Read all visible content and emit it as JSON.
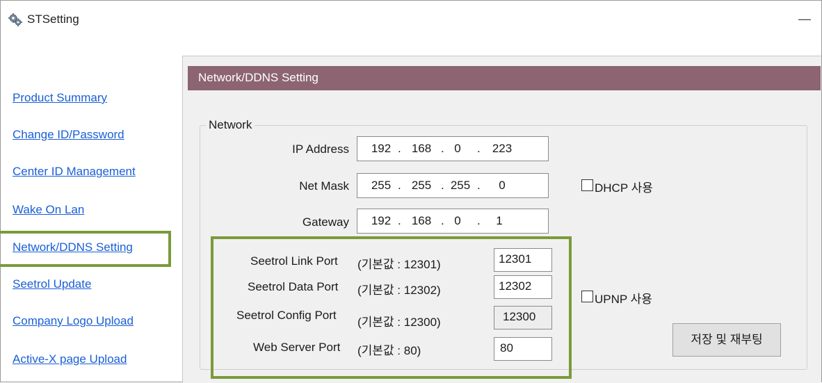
{
  "window": {
    "title": "STSetting",
    "minimize_glyph": "—",
    "app_icon": "gear-icon"
  },
  "sidebar": {
    "items": [
      {
        "label": "Product Summary"
      },
      {
        "label": "Change ID/Password"
      },
      {
        "label": "Center ID Management"
      },
      {
        "label": "Wake On Lan"
      },
      {
        "label": "Network/DDNS Setting",
        "highlighted": true
      },
      {
        "label": "Seetrol Update"
      },
      {
        "label": "Company Logo Upload"
      },
      {
        "label": "Active-X page Upload"
      }
    ]
  },
  "panel": {
    "header": "Network/DDNS Setting",
    "group_label": "Network",
    "ip_address": {
      "label": "IP Address",
      "octets": [
        "192",
        "168",
        "0",
        "223"
      ]
    },
    "net_mask": {
      "label": "Net Mask",
      "octets": [
        "255",
        "255",
        "255",
        "0"
      ]
    },
    "gateway": {
      "label": "Gateway",
      "octets": [
        "192",
        "168",
        "0",
        "1"
      ]
    },
    "dhcp": {
      "label": "DHCP 사용",
      "checked": false
    },
    "upnp": {
      "label": "UPNP 사용",
      "checked": false
    },
    "ports": [
      {
        "label": "Seetrol Link Port",
        "default": "(기본값 : 12301)",
        "value": "12301"
      },
      {
        "label": "Seetrol Data Port",
        "default": "(기본값 : 12302)",
        "value": "12302"
      },
      {
        "label": "Seetrol Config Port",
        "default": "(기본값 : 12300)",
        "value": "12300",
        "readonly": true
      },
      {
        "label": "Web Server Port",
        "default": "(기본값 : 80)",
        "value": "80"
      }
    ],
    "save_button": "저장 및 재부팅"
  },
  "colors": {
    "header_bg": "#8c6472",
    "link": "#1a5fd6",
    "highlight_border": "#7b9a3c",
    "panel_bg": "#f0f0f0"
  }
}
